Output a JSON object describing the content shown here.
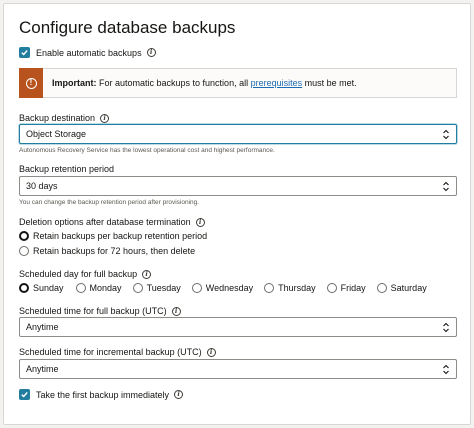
{
  "title": "Configure database backups",
  "enable_auto": {
    "label": "Enable automatic backups",
    "checked": true
  },
  "banner": {
    "strong": "Important:",
    "text_before": " For automatic backups to function, all ",
    "link": "prerequisites",
    "text_after": " must be met.",
    "icon": "warning-icon"
  },
  "backup_destination": {
    "label": "Backup destination",
    "value": "Object Storage",
    "help": "Autonomous Recovery Service has the lowest operational cost and highest performance."
  },
  "retention": {
    "label": "Backup retention period",
    "value": "30 days",
    "help": "You can change the backup retention period after provisioning."
  },
  "deletion": {
    "label": "Deletion options after database termination",
    "options": [
      "Retain backups per backup retention period",
      "Retain backups for 72 hours, then delete"
    ],
    "selected": 0
  },
  "full_day": {
    "label": "Scheduled day for full backup",
    "options": [
      "Sunday",
      "Monday",
      "Tuesday",
      "Wednesday",
      "Thursday",
      "Friday",
      "Saturday"
    ],
    "selected": 0
  },
  "full_time": {
    "label": "Scheduled time for full backup (UTC)",
    "value": "Anytime"
  },
  "incr_time": {
    "label": "Scheduled time for incremental backup (UTC)",
    "value": "Anytime"
  },
  "first_backup": {
    "label": "Take the first backup immediately",
    "checked": true
  },
  "colors": {
    "accent": "#227e9e",
    "warning": "#b8531e",
    "link": "#1c6ab1"
  }
}
